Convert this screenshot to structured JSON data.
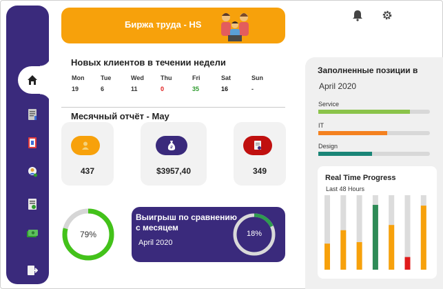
{
  "header": {
    "title": "Биржа труда - HS"
  },
  "weekly": {
    "title": "Новых клиентов в течении недели",
    "days": [
      {
        "label": "Mon",
        "value": "19",
        "color": "#333333"
      },
      {
        "label": "Tue",
        "value": "6",
        "color": "#333333"
      },
      {
        "label": "Wed",
        "value": "11",
        "color": "#333333"
      },
      {
        "label": "Thu",
        "value": "0",
        "color": "#e01b1b"
      },
      {
        "label": "Fri",
        "value": "35",
        "color": "#2e9b2e"
      },
      {
        "label": "Sat",
        "value": "16",
        "color": "#111111"
      },
      {
        "label": "Sun",
        "value": "-",
        "color": "#333333"
      }
    ]
  },
  "monthly": {
    "title": "Месячный отчёт - May",
    "cards": [
      {
        "icon": "user-icon",
        "value": "437",
        "color": "#f7a10b"
      },
      {
        "icon": "money-bag-icon",
        "value": "$3957,40",
        "color": "#3a2a7c"
      },
      {
        "icon": "document-check-icon",
        "value": "349",
        "color": "#c0100f"
      }
    ]
  },
  "gauge": {
    "percent": 79,
    "label": "79%"
  },
  "compare": {
    "title": "Выигрыш по сравнению с месяцем",
    "month": "April 2020",
    "percent": 18,
    "label": "18%"
  },
  "positions": {
    "title": "Заполненные позиции в",
    "month": "April 2020",
    "items": [
      {
        "label": "Service",
        "fraction": 0.82,
        "color": "#8bc34a"
      },
      {
        "label": "IT",
        "fraction": 0.62,
        "color": "#f4811f"
      },
      {
        "label": "Design",
        "fraction": 0.48,
        "color": "#1a8577"
      }
    ]
  },
  "realtime": {
    "title": "Real Time Progress",
    "subtitle": "Last 48 Hours",
    "bars": [
      {
        "fraction": 0.35,
        "color": "#f7a10b"
      },
      {
        "fraction": 0.53,
        "color": "#f7a10b"
      },
      {
        "fraction": 0.37,
        "color": "#f7a10b"
      },
      {
        "fraction": 0.87,
        "color": "#2e8b57"
      },
      {
        "fraction": 0.6,
        "color": "#f7a10b"
      },
      {
        "fraction": 0.17,
        "color": "#e01b1b"
      },
      {
        "fraction": 0.86,
        "color": "#f7a10b"
      }
    ]
  },
  "sidebar": {
    "items": [
      "home-icon",
      "notes-icon",
      "book-icon",
      "user-settings-icon",
      "report-icon",
      "money-icon",
      "logout-icon"
    ]
  },
  "topbar": {
    "icons": [
      "bell-icon",
      "gear-icon"
    ]
  }
}
